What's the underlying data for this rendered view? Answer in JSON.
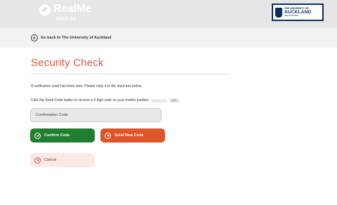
{
  "header": {
    "logo_name": "RealMe",
    "logo_sub": "Send Au",
    "uni_logo": {
      "line1": "THE UNIVERSITY OF",
      "line2": "AUCKLAND",
      "line3": "NEW ZEALAND"
    }
  },
  "backbar": {
    "link_label": "Go back to The University of Auckland",
    "icon": "arrow-left-circle-icon"
  },
  "main": {
    "title": "Security Check",
    "message_sent": "A verification code has been sent. Please copy it to the input box below.",
    "message_send_code": "Click the Send Code button to receive a 6 digit code on your mobile number",
    "edit_label": "(edit)",
    "code_input": {
      "value": "",
      "placeholder": "Confirmation Code"
    },
    "buttons": {
      "confirm_label": "Confirm Code",
      "confirm_icon": "check-circle-icon",
      "send_label": "Send New Code",
      "send_icon": "arrow-right-circle-icon",
      "cancel_label": "Cancel",
      "cancel_icon": "x-circle-icon"
    }
  },
  "colors": {
    "title": "#e2583e",
    "confirm": "#1f7f2e",
    "send": "#dd5528",
    "cancel_bg": "#fbe9e3",
    "header_bg": "#e6e6e6",
    "backbar_bg": "#f2f2f2",
    "uni_navy": "#0b2d63"
  }
}
